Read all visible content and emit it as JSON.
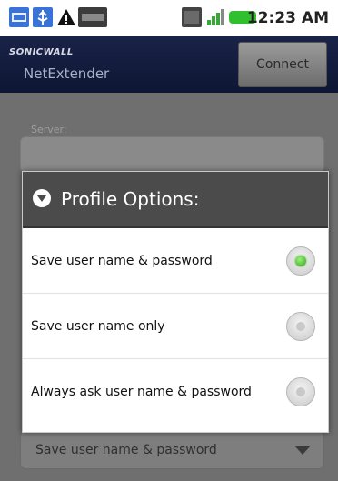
{
  "status_bar": {
    "time": "12:23 AM",
    "icons": [
      "notification-icon",
      "usb-icon",
      "warning-icon",
      "battery-percent-icon",
      "3g-network-icon",
      "signal-strength-icon",
      "battery-icon"
    ]
  },
  "app_bar": {
    "brand": "SONICWALL",
    "app_name": "NetExtender",
    "connect_label": "Connect"
  },
  "form": {
    "server_label": "Server:",
    "profile_select_value": "Save user name & password"
  },
  "dialog": {
    "title": "Profile Options:",
    "icon": "chevron-down-circle-icon",
    "options": [
      {
        "label": "Save user name & password",
        "selected": true
      },
      {
        "label": "Save user name only",
        "selected": false
      },
      {
        "label": "Always ask user name & password",
        "selected": false
      }
    ]
  },
  "colors": {
    "app_bar": "#0e1634",
    "dialog_header": "#4b4b4b",
    "radio_selected": "#2fa31f",
    "battery": "#2fbf2f"
  }
}
